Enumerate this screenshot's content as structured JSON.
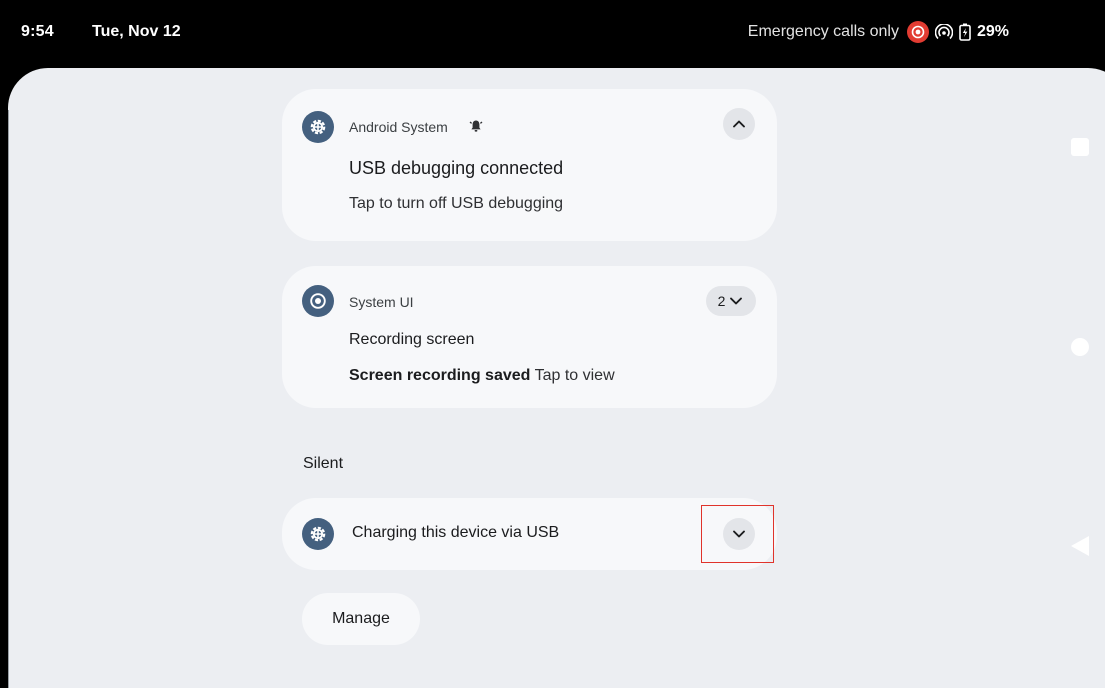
{
  "status_bar": {
    "time": "9:54",
    "date": "Tue, Nov 12",
    "network_text": "Emergency calls only",
    "battery": "29%",
    "icons": [
      "screen-record-icon",
      "hotspot-icon",
      "battery-charging-icon"
    ]
  },
  "notifications": [
    {
      "app_name": "Android System",
      "app_icon": "gear-icon",
      "badge_icon": "alert-bell-icon",
      "title": "USB debugging connected",
      "text": "Tap to turn off USB debugging",
      "action": "collapse"
    },
    {
      "app_name": "System UI",
      "app_icon": "screen-record-icon",
      "count": "2",
      "title": "Recording screen",
      "text_bold": "Screen recording saved",
      "text": "Tap to view",
      "action": "expand"
    }
  ],
  "silent_section": {
    "label": "Silent",
    "notification": {
      "app_icon": "gear-icon",
      "title": "Charging this device via USB",
      "action": "expand"
    }
  },
  "manage_label": "Manage",
  "colors": {
    "status_bar_bg": "#000000",
    "shade_bg": "#eceef2",
    "card_bg": "#f7f8fa",
    "icon_bg": "#44607f",
    "record_red": "#e23c32",
    "highlight": "#e0332b"
  },
  "nav_bar": [
    "recents-icon",
    "home-icon",
    "back-icon"
  ]
}
